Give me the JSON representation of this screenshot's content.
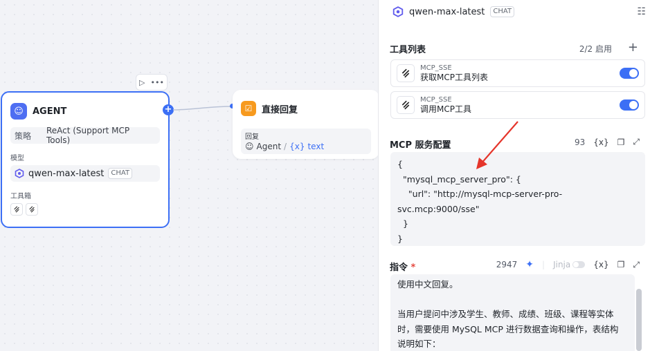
{
  "canvas": {
    "agent_node": {
      "title": "AGENT",
      "strategy_label": "策略",
      "strategy_value": "ReAct (Support MCP Tools)",
      "model_label": "模型",
      "model_name": "qwen-max-latest",
      "model_badge": "CHAT",
      "toolbox_label": "工具箱",
      "toolbar_run_icon": "play-icon",
      "toolbar_more_icon": "more-icon"
    },
    "reply_node": {
      "title": "直接回复",
      "field_label": "回复",
      "ref_source": "Agent",
      "ref_separator": "/",
      "ref_var_icon": "{x}",
      "ref_var": "text"
    }
  },
  "panel": {
    "model_name": "qwen-max-latest",
    "model_badge": "CHAT",
    "tools": {
      "title": "工具列表",
      "count": "2/2 启用",
      "items": [
        {
          "provider": "MCP_SSE",
          "name": "获取MCP工具列表",
          "enabled": true
        },
        {
          "provider": "MCP_SSE",
          "name": "调用MCP工具",
          "enabled": true
        }
      ]
    },
    "mcp_config": {
      "title": "MCP 服务配置",
      "count": "93",
      "var_button": "{x}",
      "code_lines": [
        "{",
        "  \"mysql_mcp_server_pro\": {",
        "    \"url\": \"http://mysql-mcp-server-pro-",
        "svc.mcp:9000/sse\"",
        "  }",
        "}"
      ]
    },
    "instruction": {
      "title": "指令",
      "required_mark": "*",
      "count": "2947",
      "jinja_label": "Jinja",
      "var_button": "{x}",
      "lines": [
        "使用中文回复。",
        "",
        "当用户提问中涉及学生、教师、成绩、班级、课程等实体",
        "时，需要使用 MySQL MCP 进行数据查询和操作，表结构",
        "说明如下："
      ]
    }
  },
  "colors": {
    "accent": "#3c6ff5",
    "reply_node": "#f79a1e",
    "arrow": "#e5352b"
  }
}
